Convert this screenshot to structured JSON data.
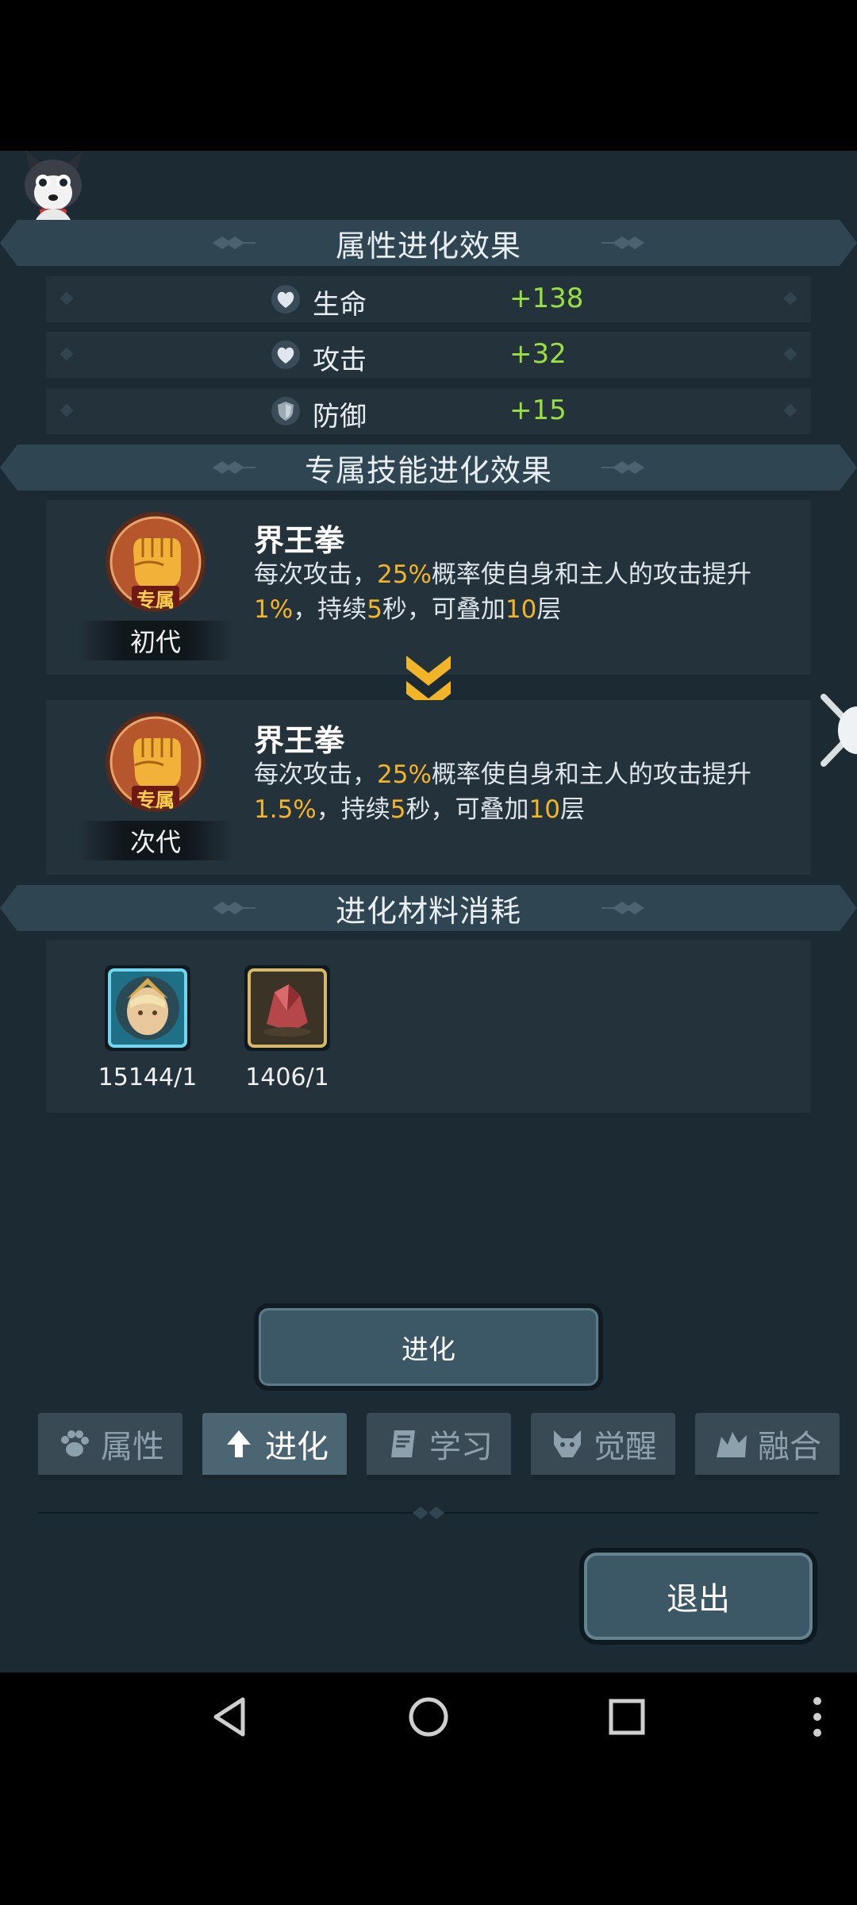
{
  "attribute_section": {
    "title": "属性进化效果",
    "stats": [
      {
        "label": "生命",
        "value": "+138"
      },
      {
        "label": "攻击",
        "value": "+32"
      },
      {
        "label": "防御",
        "value": "+15"
      }
    ]
  },
  "skill_section": {
    "title": "专属技能进化效果",
    "badge_text": "专属",
    "current": {
      "generation": "初代",
      "name": "界王拳",
      "desc_parts": [
        "每次攻击，",
        "25%",
        "概率使自身和主人的攻击提升",
        "1%",
        "，持续",
        "5",
        "秒，可叠加",
        "10",
        "层"
      ]
    },
    "next": {
      "generation": "次代",
      "name": "界王拳",
      "desc_parts": [
        "每次攻击，",
        "25%",
        "概率使自身和主人的攻击提升",
        "1.5%",
        "，持续",
        "5",
        "秒，可叠加",
        "10",
        "层"
      ]
    }
  },
  "material_section": {
    "title": "进化材料消耗",
    "items": [
      {
        "icon": "hero-portrait-icon",
        "count": "15144/1"
      },
      {
        "icon": "red-crystal-icon",
        "count": "1406/1"
      }
    ]
  },
  "evolve_button": "进化",
  "tabs": [
    {
      "label": "属性",
      "icon": "paw-icon",
      "active": false
    },
    {
      "label": "进化",
      "icon": "arrow-up-icon",
      "active": true
    },
    {
      "label": "学习",
      "icon": "book-icon",
      "active": false
    },
    {
      "label": "觉醒",
      "icon": "wolf-head-icon",
      "active": false
    },
    {
      "label": "融合",
      "icon": "fusion-icon",
      "active": false
    }
  ],
  "exit_button": "退出",
  "colors": {
    "positive": "#9adf42",
    "highlight": "#f2b52a",
    "panel": "#1c2a33"
  },
  "navbar": [
    "back-icon",
    "home-icon",
    "recents-icon",
    "more-icon"
  ]
}
